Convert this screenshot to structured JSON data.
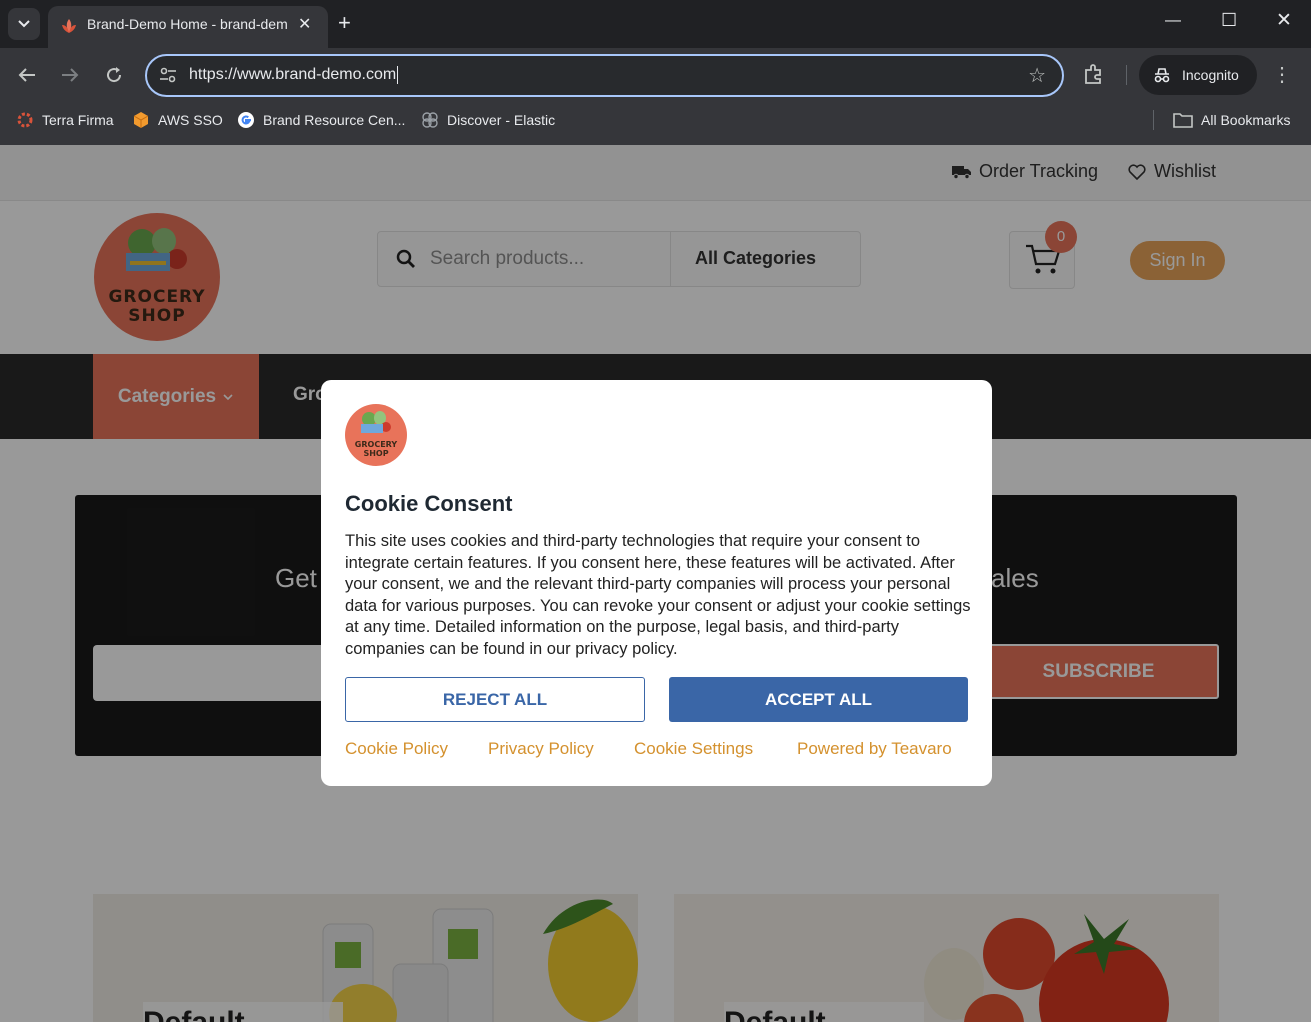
{
  "browser": {
    "tab_title": "Brand-Demo Home - brand-demo",
    "url": "https://www.brand-demo.com",
    "incognito_label": "Incognito",
    "bookmarks": [
      "Terra Firma",
      "AWS SSO",
      "Brand Resource Cen...",
      "Discover - Elastic"
    ],
    "all_bookmarks": "All Bookmarks"
  },
  "site": {
    "topbar": {
      "order_tracking": "Order Tracking",
      "wishlist": "Wishlist"
    },
    "logo_line1": "GROCERY",
    "logo_line2": "SHOP",
    "search_placeholder": "Search products...",
    "category_select": "All Categories",
    "cart_count": "0",
    "sign_in": "Sign In",
    "nav": {
      "categories": "Categories",
      "item2": "Gro"
    },
    "newsletter": {
      "title_left": "Get",
      "title_right": "ales",
      "button": "SUBSCRIBE"
    },
    "cards": [
      "Default",
      "Default"
    ]
  },
  "cookie": {
    "logo_line1": "GROCERY",
    "logo_line2": "SHOP",
    "title": "Cookie Consent",
    "body": "This site uses cookies and third-party technologies that require your consent to integrate certain features. If you consent here, these features will be activated. After your consent, we and the relevant third-party companies will process your personal data for various purposes. You can revoke your consent or adjust your cookie settings at any time. Detailed information on the purpose, legal basis, and third-party companies can be found in our privacy policy.",
    "reject": "REJECT ALL",
    "accept": "ACCEPT ALL",
    "links": {
      "cookie_policy": "Cookie Policy",
      "privacy_policy": "Privacy Policy",
      "cookie_settings": "Cookie Settings",
      "powered_by": "Powered by Teavaro"
    }
  },
  "colors": {
    "brand": "#e8735a",
    "accent_blue": "#3a66a7",
    "link": "#d4912e"
  }
}
